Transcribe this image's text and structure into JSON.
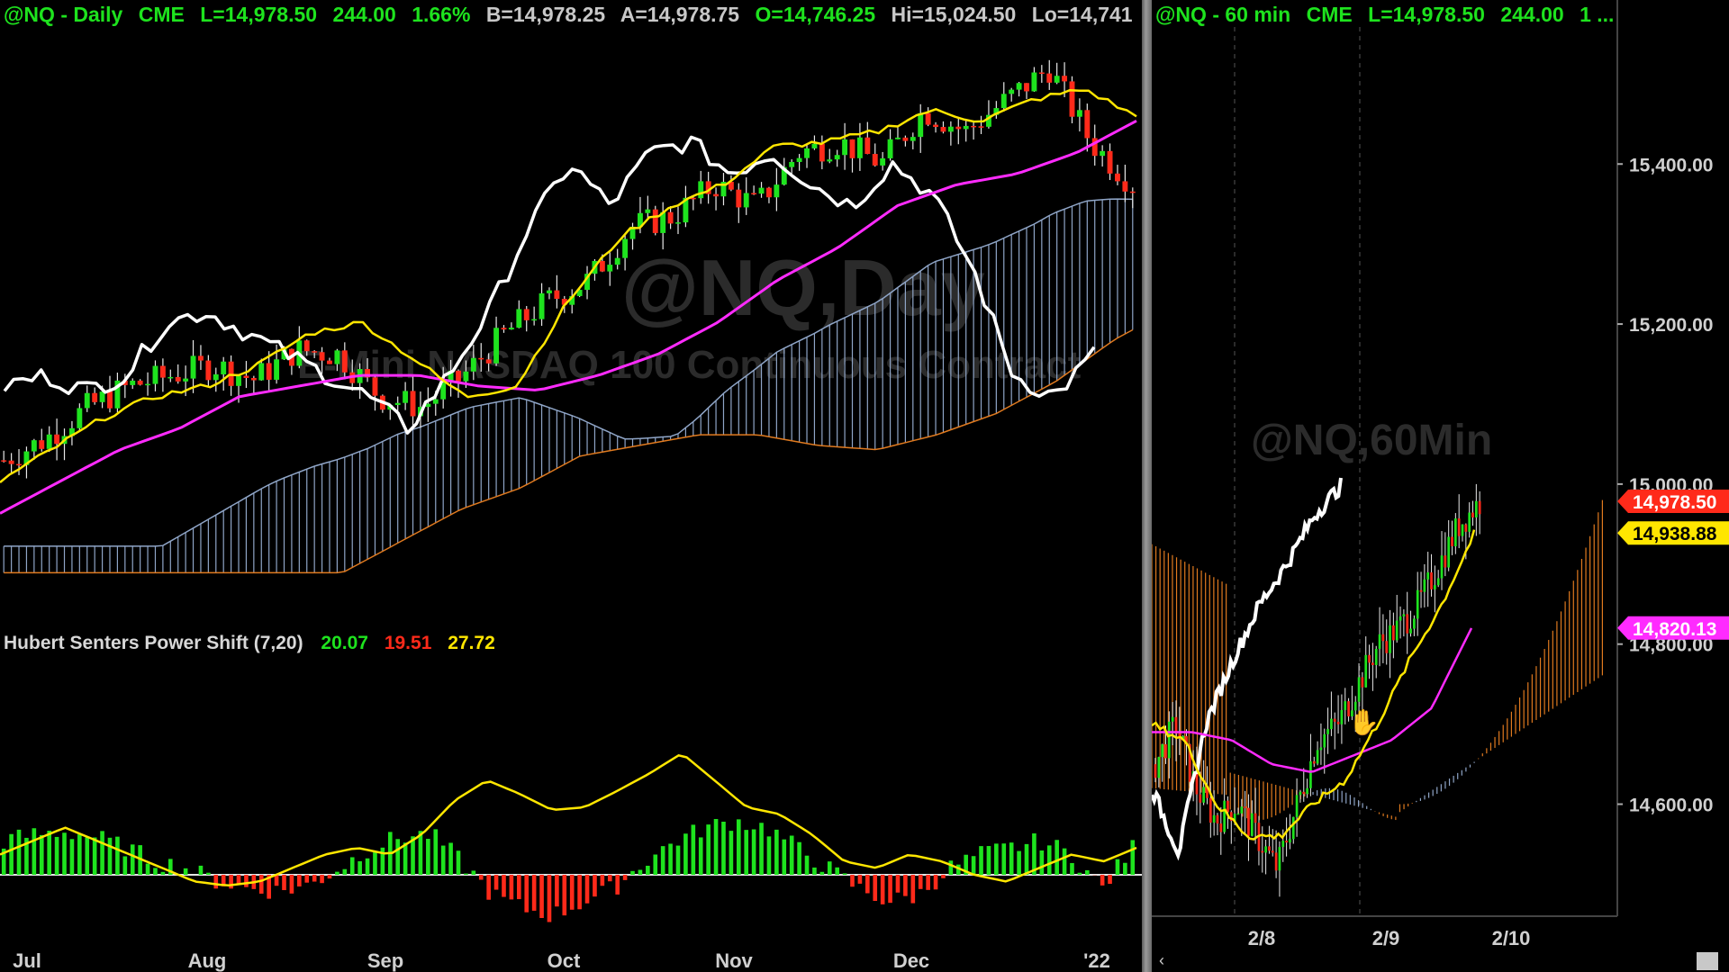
{
  "left_panel": {
    "header": {
      "symbol": "@NQ - Daily",
      "exchange": "CME",
      "last": "L=14,978.50",
      "change": "244.00",
      "change_pct": "1.66%",
      "bid": "B=14,978.25",
      "ask": "A=14,978.75",
      "open": "O=14,746.25",
      "high": "Hi=15,024.50",
      "low": "Lo=14,741"
    },
    "watermark_symbol": "@NQ,Day",
    "watermark_desc": "E-Mini NASDAQ 100 Continuous Contract",
    "indicator": {
      "name": "Hubert Senters Power Shift (7,20)",
      "v1": "20.07",
      "v2": "19.51",
      "v3": "27.72"
    },
    "x_axis_labels": [
      "Jul",
      "Aug",
      "Sep",
      "Oct",
      "Nov",
      "Dec",
      "'22"
    ]
  },
  "right_panel": {
    "header": {
      "symbol": "@NQ - 60 min",
      "exchange": "CME",
      "last": "L=14,978.50",
      "change": "244.00",
      "more": "1 ..."
    },
    "watermark_symbol": "@NQ,60Min",
    "price_axis": [
      "15,400.00",
      "15,200.00",
      "15,000.00",
      "14,800.00",
      "14,600.00"
    ],
    "markers": [
      {
        "label": "14,978.50",
        "color": "#ff2a1a"
      },
      {
        "label": "14,938.88",
        "color": "#ffe600"
      },
      {
        "label": "14,820.13",
        "color": "#ff2bff"
      }
    ],
    "x_axis_labels": [
      "2/8",
      "2/9",
      "2/10"
    ]
  },
  "colors": {
    "up": "#1ee31e",
    "down": "#ff2a1a",
    "yellow": "#ffe600",
    "magenta": "#ff2bff",
    "white": "#ffffff",
    "cloud_blue": "#8fa5c7",
    "cloud_orange": "#e07a1f"
  },
  "chart_data": [
    {
      "type": "candlestick",
      "title": "@NQ - Daily",
      "x": [
        "Jul",
        "Aug",
        "Sep",
        "Oct",
        "Nov",
        "Dec",
        "'22"
      ],
      "ylim": [
        14000,
        16800
      ],
      "series": [
        {
          "name": "price",
          "values": [
            14800,
            14900,
            15050,
            15150,
            15200,
            15250,
            15180,
            15320,
            15300,
            15100,
            15050,
            15200,
            15400,
            15550,
            15650,
            15900,
            15950,
            16100,
            16000,
            16250,
            16300,
            16200,
            16450,
            16350,
            16500,
            16650,
            16300,
            16100
          ]
        },
        {
          "name": "conversion",
          "values": [
            14700,
            14850,
            15000,
            15100,
            15150,
            15250,
            15400,
            15450,
            15280,
            15100,
            15150,
            15550,
            15850,
            16000,
            16100,
            16280,
            16300,
            16350,
            16450,
            16400,
            16500,
            16550,
            16420
          ]
        },
        {
          "name": "base",
          "values": [
            14550,
            14700,
            14850,
            14950,
            15100,
            15150,
            15200,
            15200,
            15150,
            15130,
            15200,
            15300,
            15450,
            15650,
            15800,
            16000,
            16100,
            16150,
            16250,
            16400
          ]
        },
        {
          "name": "lagging",
          "values": [
            15150,
            15200,
            15130,
            15200,
            15450,
            15500,
            15400,
            15300,
            15200,
            15100,
            14950,
            15200,
            15500,
            15900,
            16200,
            16000,
            16250,
            16300,
            16150,
            16250,
            16100,
            16000,
            16200,
            16050,
            15700,
            15200,
            15100,
            15300
          ]
        }
      ]
    },
    {
      "type": "bar",
      "title": "Hubert Senters Power Shift (7,20)",
      "series": [
        {
          "name": "histogram",
          "values": [
            25,
            30,
            32,
            28,
            20,
            10,
            5,
            -5,
            -10,
            -12,
            -8,
            5,
            20,
            28,
            30,
            10,
            -15,
            -25,
            -30,
            -20,
            -10,
            10,
            25,
            35,
            40,
            35,
            20,
            5,
            -10,
            -20,
            -15,
            5,
            15,
            20,
            25,
            15,
            -10,
            20
          ]
        },
        {
          "name": "signal",
          "values": [
            15,
            25,
            35,
            25,
            15,
            5,
            -5,
            -8,
            -5,
            5,
            15,
            20,
            15,
            30,
            55,
            70,
            60,
            48,
            50,
            62,
            75,
            90,
            70,
            50,
            45,
            30,
            10,
            5,
            15,
            10,
            0,
            -5,
            5,
            15,
            10,
            20
          ]
        }
      ]
    },
    {
      "type": "candlestick",
      "title": "@NQ - 60 min",
      "x": [
        "2/8",
        "2/9",
        "2/10"
      ],
      "ylim": [
        14460,
        15560
      ],
      "series": [
        {
          "name": "price",
          "values": [
            14650,
            14700,
            14620,
            14580,
            14600,
            14560,
            14520,
            14600,
            14680,
            14700,
            14750,
            14800,
            14820,
            14850,
            14900,
            14950,
            14978
          ]
        },
        {
          "name": "conversion",
          "values": [
            14700,
            14680,
            14600,
            14560,
            14560,
            14600,
            14630,
            14700,
            14780,
            14850,
            14938
          ]
        },
        {
          "name": "base",
          "values": [
            14690,
            14690,
            14680,
            14650,
            14640,
            14660,
            14680,
            14720,
            14820
          ]
        },
        {
          "name": "lagging",
          "values": [
            14620,
            14540,
            14700,
            14780,
            14850,
            14900,
            14960,
            14998
          ]
        }
      ]
    }
  ]
}
